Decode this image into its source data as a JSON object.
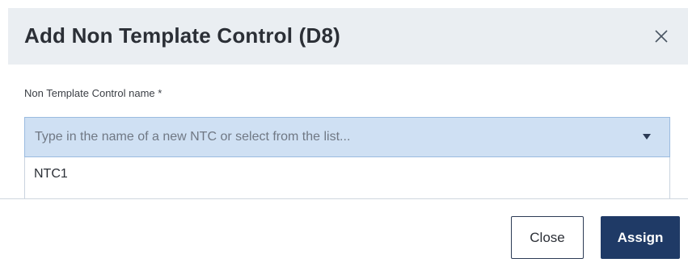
{
  "dialog": {
    "title": "Add Non Template Control (D8)",
    "close_icon": "close-icon"
  },
  "form": {
    "field_label": "Non Template Control name *",
    "input_value": "",
    "input_placeholder": "Type in the name of a new NTC or select from the list...",
    "dropdown_icon": "caret-down-icon",
    "options": [
      "NTC1"
    ]
  },
  "footer": {
    "close_label": "Close",
    "assign_label": "Assign"
  },
  "colors": {
    "header_bg": "#eaeef2",
    "input_bg": "#cfe0f3",
    "primary": "#1f3a66"
  }
}
